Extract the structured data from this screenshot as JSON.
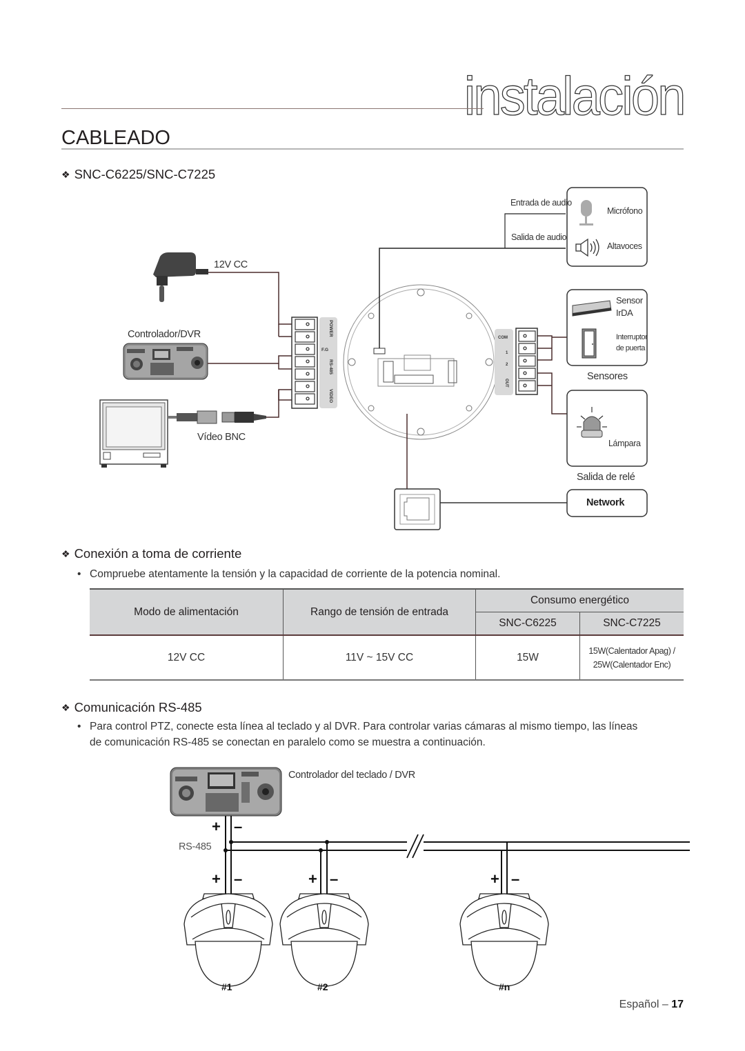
{
  "header": {
    "chapter_title": "instalación",
    "section_title": "CABLEADO"
  },
  "wiring_diagram": {
    "heading": "SNC-C6225/SNC-C7225",
    "heading_icon": "diamond-bullet-icon",
    "labels": {
      "power_12v": "12V CC",
      "controller_dvr": "Controlador/DVR",
      "video_bnc": "Vídeo BNC",
      "audio_in": "Entrada de audio",
      "audio_out": "Salida de audio",
      "microphone": "Micrófono",
      "speakers": "Altavoces",
      "sensor_irda_1": "Sensor",
      "sensor_irda_2": "IrDA",
      "door_switch_1": "Interruptor",
      "door_switch_2": "de puerta",
      "sensors": "Sensores",
      "lamp": "Lámpara",
      "relay_output": "Salida de relé",
      "network": "Network"
    },
    "terminal_left": [
      "POWER",
      "F.G",
      "RS-485",
      "VIDEO"
    ],
    "terminal_right": [
      "COM",
      "1",
      "2",
      "OUT"
    ],
    "icons": [
      "power-adapter-icon",
      "controller-keyboard-icon",
      "monitor-icon",
      "bnc-connector-icon",
      "camera-base-icon",
      "microphone-icon",
      "speaker-icon",
      "irda-sensor-icon",
      "door-switch-icon",
      "lamp-icon",
      "rj45-port-icon"
    ]
  },
  "power_section": {
    "heading": "Conexión a toma de corriente",
    "bullet": "Compruebe atentamente la tensión y la capacidad de corriente de la potencia nominal.",
    "table": {
      "headers": {
        "mode": "Modo de alimentación",
        "range": "Rango de tensión de entrada",
        "consumption": "Consumo energético",
        "model_a": "SNC-C6225",
        "model_b": "SNC-C7225"
      },
      "rows": [
        {
          "mode": "12V CC",
          "range": "11V ~ 15V CC",
          "model_a": "15W",
          "model_b_line1": "15W(Calentador Apag) /",
          "model_b_line2": "25W(Calentador Enc)"
        }
      ]
    }
  },
  "rs485_section": {
    "heading": "Comunicación RS-485",
    "bullet_line1": "Para control PTZ, conecte esta línea al teclado y al DVR. Para controlar varias cámaras al mismo tiempo, las líneas",
    "bullet_line2": "de comunicación RS-485 se conectan en paralelo como se muestra a continuación.",
    "diagram": {
      "controller_label": "Controlador del teclado / DVR",
      "bus_label": "RS-485",
      "plus": "+",
      "minus": "–",
      "cameras": [
        "#1",
        "#2",
        "#n"
      ]
    }
  },
  "footer": {
    "language": "Español –",
    "page_number": "17"
  }
}
